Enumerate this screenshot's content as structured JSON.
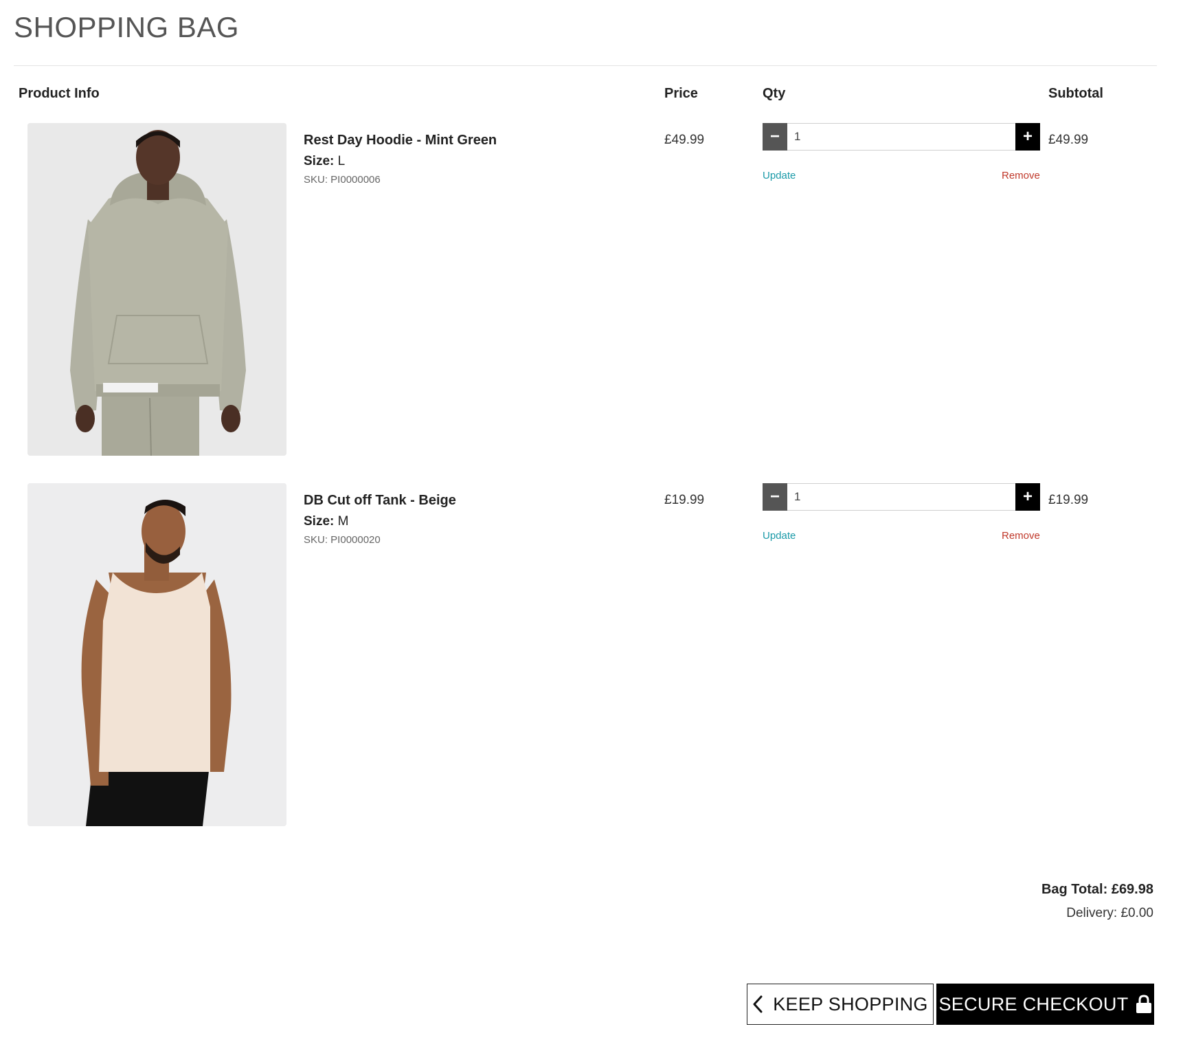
{
  "page": {
    "title": "SHOPPING BAG"
  },
  "columns": {
    "product_info": "Product Info",
    "price": "Price",
    "qty": "Qty",
    "subtotal": "Subtotal"
  },
  "labels": {
    "size": "Size:",
    "update": "Update",
    "remove": "Remove",
    "minus": "−",
    "plus": "+"
  },
  "items": [
    {
      "name": "Rest Day Hoodie - Mint Green",
      "size": "L",
      "sku": "SKU: PI0000006",
      "price": "£49.99",
      "qty": "1",
      "subtotal": "£49.99"
    },
    {
      "name": "DB Cut off Tank - Beige",
      "size": "M",
      "sku": "SKU: PI0000020",
      "price": "£19.99",
      "qty": "1",
      "subtotal": "£19.99"
    }
  ],
  "totals": {
    "bag_total": "Bag Total: £69.98",
    "delivery": "Delivery: £0.00"
  },
  "actions": {
    "keep_shopping": "KEEP SHOPPING",
    "secure_checkout": "SECURE CHECKOUT"
  },
  "icons": {
    "back": "chevron-left-icon",
    "lock": "lock-icon"
  }
}
